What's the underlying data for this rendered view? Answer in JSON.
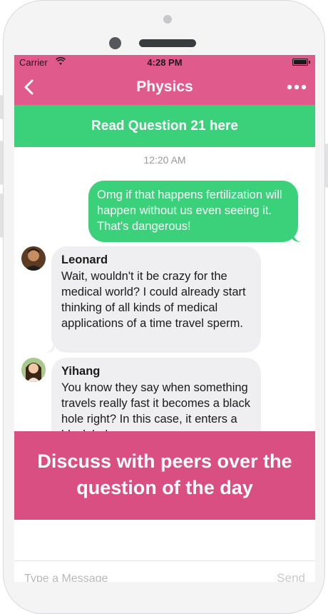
{
  "status_bar": {
    "carrier": "Carrier",
    "time": "4:28 PM"
  },
  "nav": {
    "title": "Physics",
    "back_icon": "chevron-left-icon",
    "more_icon": "more-dots-icon"
  },
  "question_banner": {
    "label": "Read Question 21 here"
  },
  "chat": {
    "timestamp": "12:20 AM",
    "messages": [
      {
        "direction": "sent",
        "text": "Omg if that happens fertilization will happen without us even seeing it. That's dangerous!"
      },
      {
        "direction": "received",
        "sender": "Leonard",
        "text": "Wait, wouldn't it be crazy for the medical world? I could already start thinking of all kinds of medical applications of a time travel sperm."
      },
      {
        "direction": "received",
        "sender": "Yihang",
        "text": "You know they say when something travels really fast it becomes a black hole right? In this case, it enters a black hole"
      }
    ]
  },
  "promo_banner": {
    "line1": "Discuss with peers over the",
    "line2": "question of the day"
  },
  "input_bar": {
    "placeholder": "Type a Message",
    "send_label": "Send"
  },
  "colors": {
    "brand_pink": "#e05a8c",
    "promo_pink": "#da4f82",
    "green": "#3bd17a",
    "received_bubble": "#efeff1"
  }
}
